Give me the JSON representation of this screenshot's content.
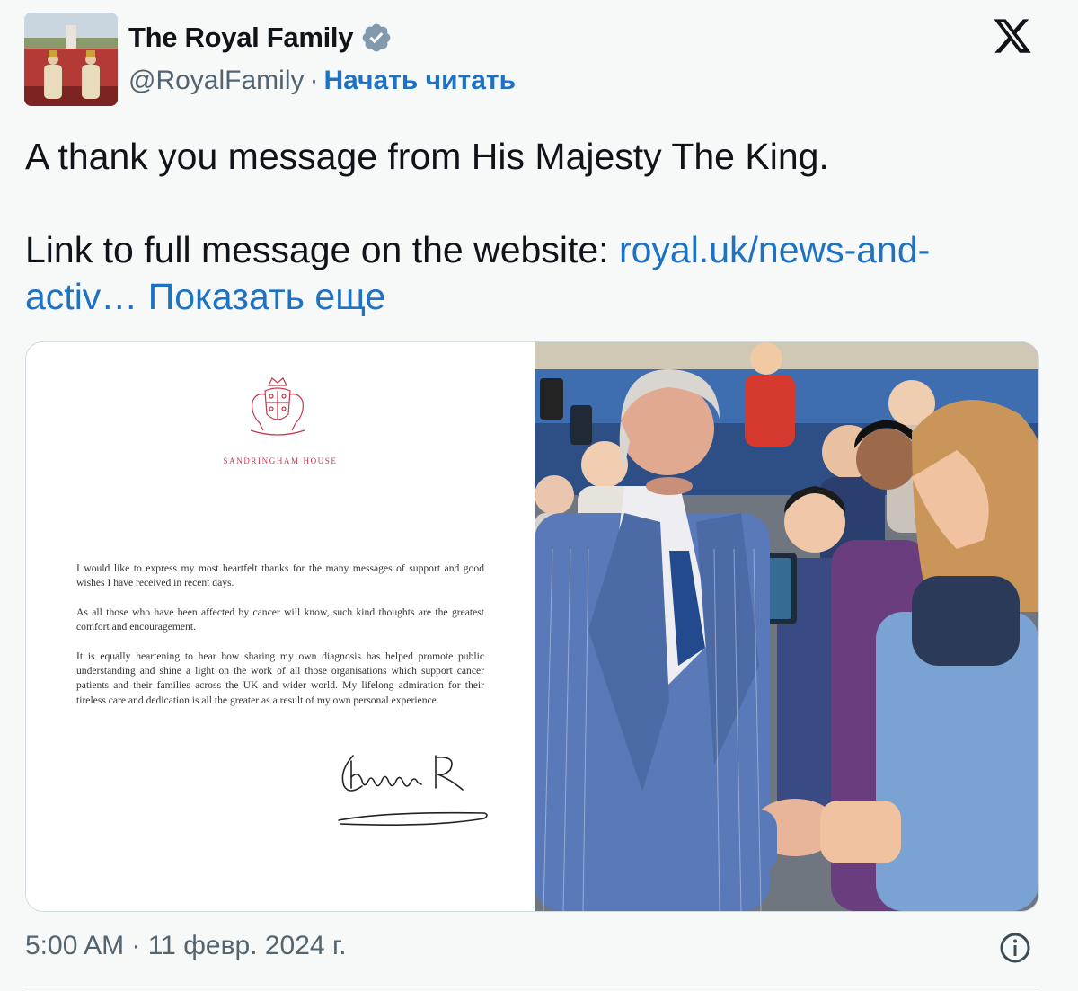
{
  "account": {
    "name": "The Royal Family",
    "handle": "@RoyalFamily",
    "separator": "·",
    "follow_label": "Начать читать",
    "verified_icon": "verified-badge-icon",
    "avatar_icon": "avatar"
  },
  "platform": {
    "logo_icon": "x-logo-icon"
  },
  "tweet": {
    "text_line1": "A thank you message from His Majesty The King.",
    "text_line2": "Link to full message on the website: ",
    "link_text": "royal.uk/news-and-activ…",
    "show_more": "Показать еще"
  },
  "letter": {
    "house": "SANDRINGHAM HOUSE",
    "paragraphs": [
      "I would like to express my most heartfelt thanks for the many messages of support and good wishes I have received in recent days.",
      "As all those who have been affected by cancer will know, such kind thoughts are the greatest comfort and encouragement.",
      "It is equally heartening to hear how sharing my own diagnosis has helped promote public understanding and shine a light on the work of all those organisations which support cancer patients and their families across the UK and wider world. My lifelong admiration for their tireless care and dedication is all the greater as a result of my own personal experience."
    ],
    "signature": "Charles R"
  },
  "footer": {
    "timestamp": "5:00 AM · 11 февр. 2024 г.",
    "info_icon": "info-icon"
  },
  "colors": {
    "link": "#1d72c4",
    "secondary_text": "#536471",
    "verified": "#829aab",
    "crest": "#c4374d",
    "background": "#f7f9f9"
  }
}
